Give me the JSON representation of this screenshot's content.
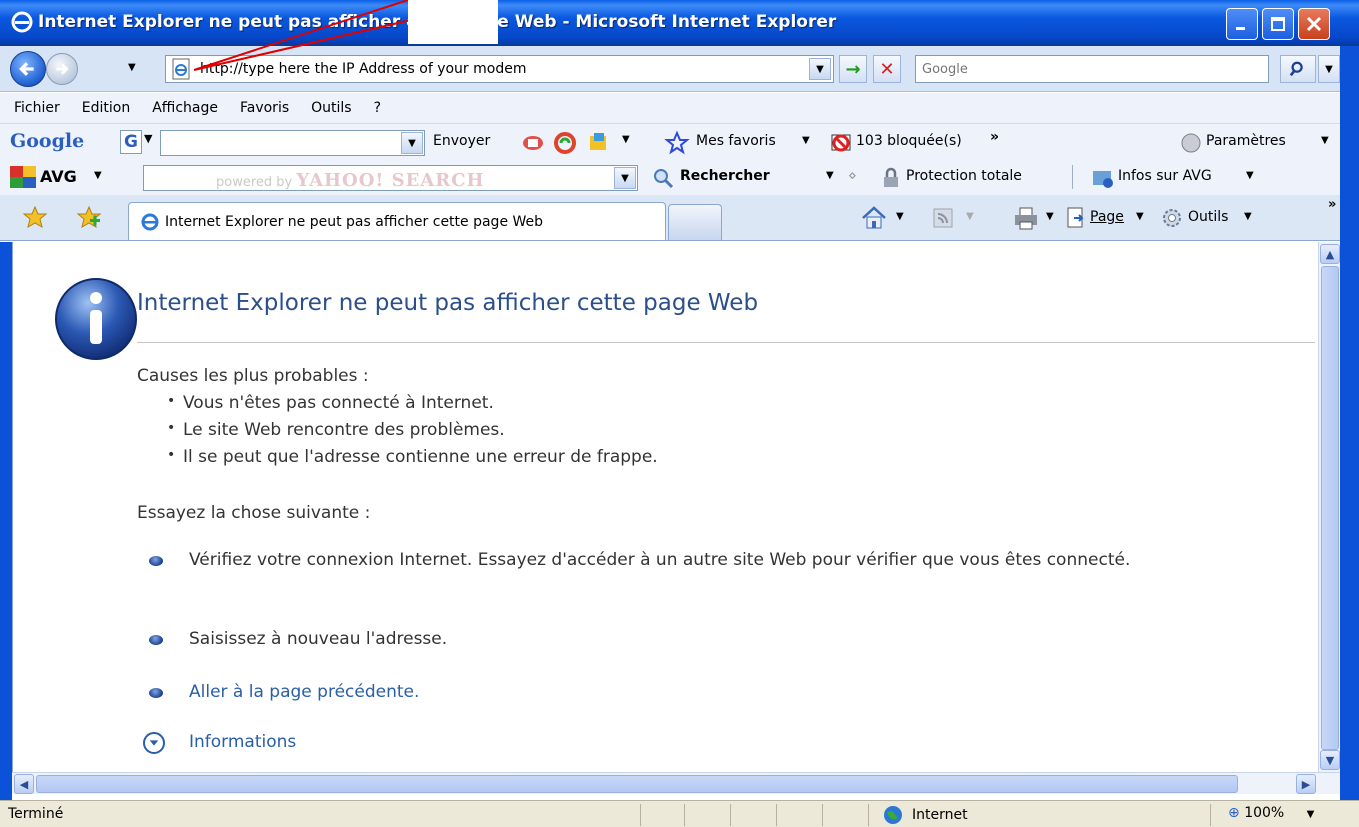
{
  "window": {
    "title": "Internet Explorer ne peut pas afficher cette page Web - Microsoft Internet Explorer"
  },
  "address": {
    "url": "http://type here the IP Address of your modem",
    "search_placeholder": "Google"
  },
  "menu": {
    "items": [
      "Fichier",
      "Edition",
      "Affichage",
      "Favoris",
      "Outils",
      "?"
    ]
  },
  "google_toolbar": {
    "logo": "Google",
    "send_label": "Envoyer",
    "favorites_label": "Mes favoris",
    "blocked_label": "103 bloquée(s)",
    "settings_label": "Paramètres",
    "more": "»"
  },
  "avg_toolbar": {
    "logo": "AVG",
    "search_powered": "powered by",
    "search_brand": "YAHOO! SEARCH",
    "search_label": "Rechercher",
    "protection_label": "Protection totale",
    "info_label": "Infos sur AVG"
  },
  "tabs": {
    "active_label": "Internet Explorer ne peut pas afficher cette page Web",
    "page_label": "Page",
    "tools_label": "Outils"
  },
  "content": {
    "title": "Internet Explorer ne peut pas afficher cette page Web",
    "causes_heading": "Causes les plus probables :",
    "causes": [
      "Vous n'êtes pas connecté à Internet.",
      "Le site Web rencontre des problèmes.",
      "Il se peut que l'adresse contienne une erreur de frappe."
    ],
    "try_heading": "Essayez la chose suivante :",
    "suggestions": [
      "Vérifiez votre connexion Internet. Essayez d'accéder à un autre site Web pour vérifier que vous êtes connecté.",
      "Saisissez à nouveau l'adresse.",
      "Aller à la page précédente."
    ],
    "more_info": "Informations"
  },
  "status": {
    "text": "Terminé",
    "zone": "Internet",
    "zoom": "100%"
  },
  "colors": {
    "titlebar": "#0b58e0",
    "link": "#2a5ea8",
    "heading": "#2c4f8a"
  }
}
